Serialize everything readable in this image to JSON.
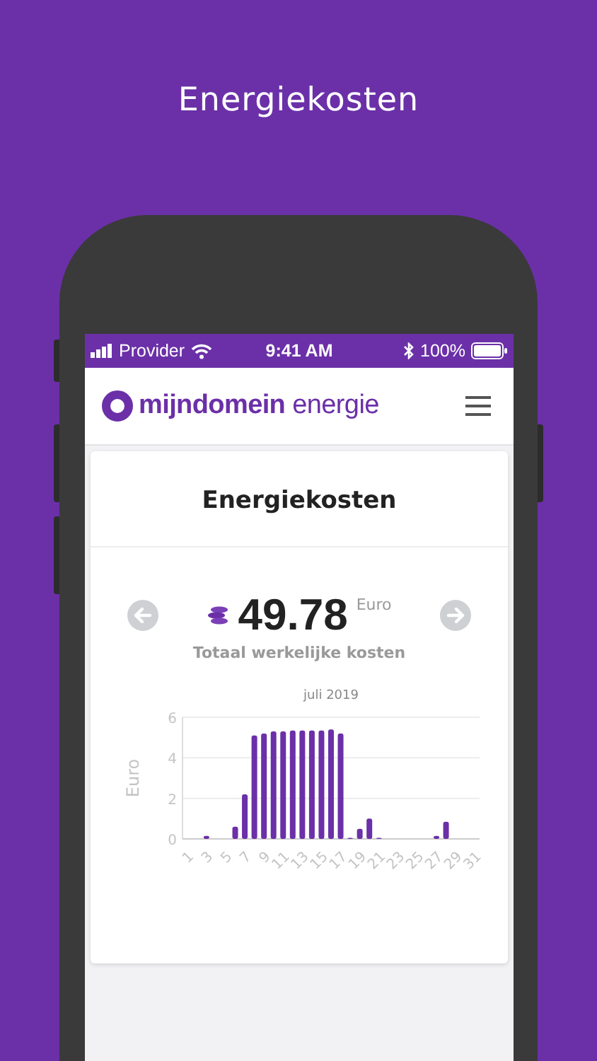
{
  "headline": "Energiekosten",
  "status_bar": {
    "carrier": "Provider",
    "time": "9:41 AM",
    "battery": "100%"
  },
  "app_header": {
    "logo": "**mijndomein** energie"
  },
  "card": {
    "title": "Energiekosten",
    "total": {
      "value": "49.78",
      "unit": "Euro",
      "caption": "Totaal werkelijke kosten"
    },
    "chart_data": {
      "type": "bar",
      "title": "juli 2019",
      "ylabel": "Euro",
      "x": [
        1,
        2,
        3,
        4,
        5,
        6,
        7,
        8,
        9,
        10,
        11,
        12,
        13,
        14,
        15,
        16,
        17,
        18,
        19,
        20,
        21,
        22,
        23,
        24,
        25,
        26,
        27,
        28,
        29,
        30,
        31
      ],
      "values": [
        0,
        0,
        0.15,
        0,
        0,
        0.6,
        2.2,
        5.1,
        5.2,
        5.3,
        5.3,
        5.35,
        5.35,
        5.35,
        5.35,
        5.4,
        5.2,
        0.05,
        0.5,
        1.0,
        0.05,
        0,
        0,
        0,
        0,
        0,
        0.15,
        0.85,
        0,
        0,
        0
      ],
      "xlim": [
        0.5,
        31.5
      ],
      "ylim": [
        0,
        6
      ],
      "yticks": [
        0,
        2,
        4,
        6
      ],
      "xticks": [
        1,
        3,
        5,
        7,
        9,
        11,
        13,
        15,
        17,
        19,
        21,
        23,
        25,
        27,
        29,
        31
      ]
    }
  }
}
